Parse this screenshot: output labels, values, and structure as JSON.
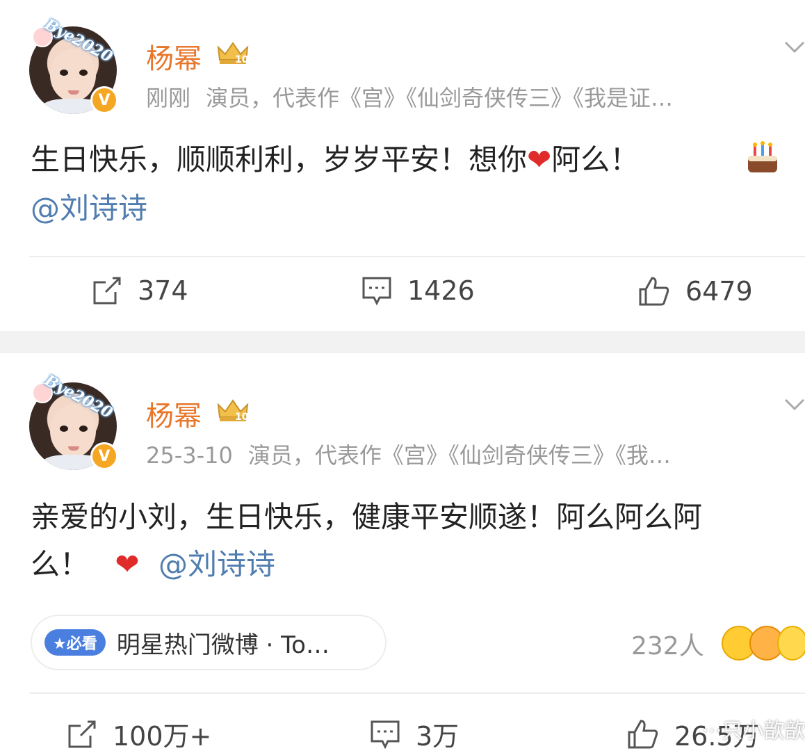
{
  "posts": [
    {
      "author": "杨幂",
      "time": "刚刚",
      "bio": "演员，代表作《宫》《仙剑奇侠传三》《我是证…",
      "text_main": "生日快乐，顺顺利利，岁岁平安！想你",
      "text_after_heart": "阿么！",
      "mention": "@刘诗诗",
      "reposts": "374",
      "comments": "1426",
      "likes": "6479"
    },
    {
      "author": "杨幂",
      "time": "25-3-10",
      "bio": "演员，代表作《宫》《仙剑奇侠传三》《我…",
      "text_line1": "亲爱的小刘，生日快乐，健康平安顺遂！阿么阿么阿",
      "text_line2": "么！",
      "mention": "@刘诗诗",
      "topic_badge": "★必看",
      "topic_text": "明星热门微博 · To…",
      "reaction_count": "232人",
      "reposts": "100万+",
      "comments": "3万",
      "likes": "26.5万"
    }
  ],
  "avatar_sticker": "Bye2020",
  "verified_badge": "V",
  "crown_level": "10",
  "watermark": "···只小歆歆",
  "icons": [
    "repost-icon",
    "comment-icon",
    "like-icon",
    "chevron-down-icon",
    "heart-emoji",
    "cake-emoji",
    "crown-icon"
  ],
  "colors": {
    "author": "#e8762b",
    "mention": "#507daf",
    "meta": "#999999",
    "badge": "#4a7fe0",
    "verified": "#f5a623"
  }
}
